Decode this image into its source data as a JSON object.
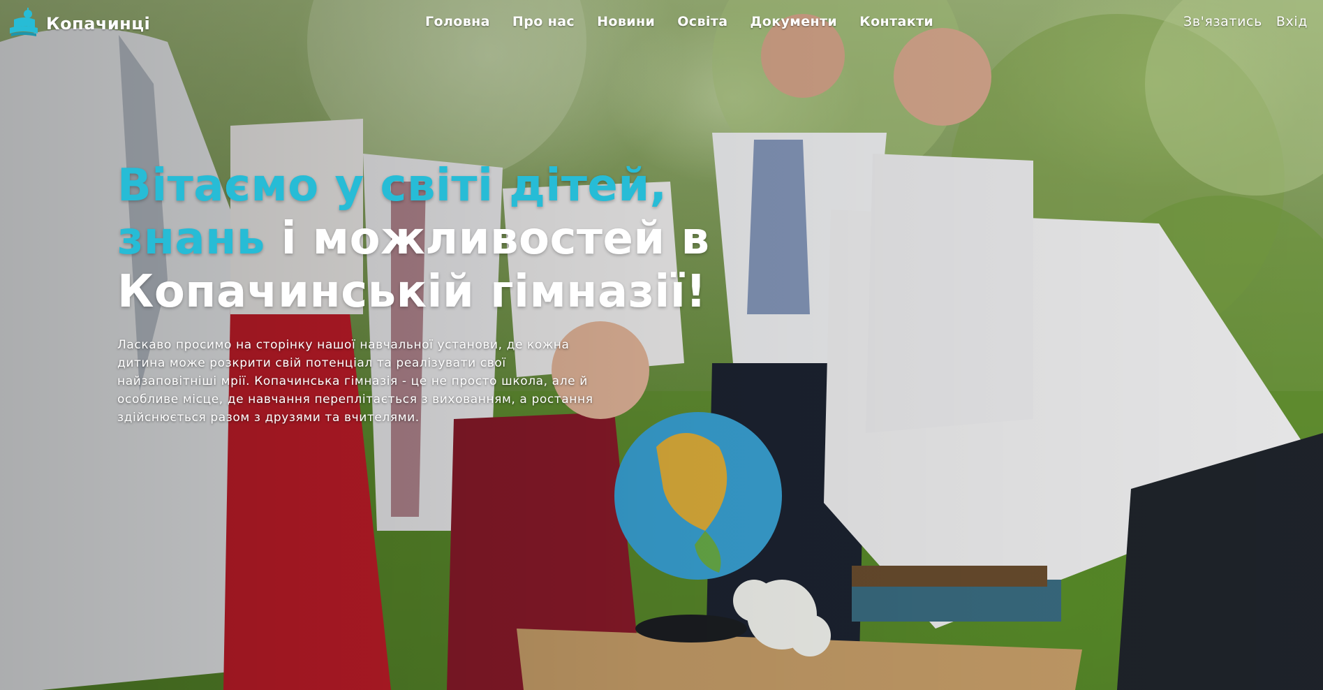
{
  "site": {
    "name": "Копачинці",
    "logo_icon": "book-globe-icon",
    "accent_color": "#27bcd6"
  },
  "nav": {
    "items": [
      {
        "label": "Головна"
      },
      {
        "label": "Про нас"
      },
      {
        "label": "Новини"
      },
      {
        "label": "Освіта"
      },
      {
        "label": "Документи"
      },
      {
        "label": "Контакти"
      }
    ]
  },
  "header_actions": {
    "contact_label": "Зв'язатись",
    "login_label": "Вхід"
  },
  "hero": {
    "title_accent_line1": "Вітаємо у світі дітей,",
    "title_accent_word": "знань",
    "title_rest_line2": " і можливостей в",
    "title_line3": "Копачинській гімназії!",
    "text": "Ласкаво просимо на сторінку нашої навчальної установи, де кожна дитина може розкрити свій потенціал та реалізувати свої найзаповітніші мрії. Копачинська гімназія - це не просто школа, але й особливе місце, де навчання переплітається з вихованням, а ростання здійснюється разом з друзями та вчителями."
  }
}
